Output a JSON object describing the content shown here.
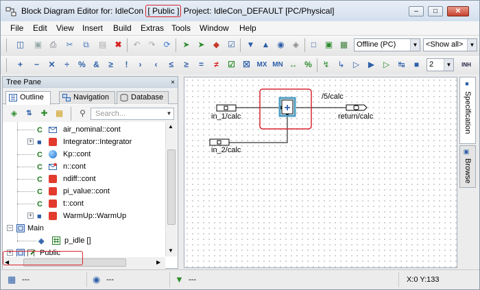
{
  "window": {
    "title_pre": "Block Diagram Editor for: IdleCon",
    "title_highlight": "[ Public ]",
    "title_post": "Project: IdleCon_DEFAULT [PC/Physical]",
    "min_label": "‒",
    "max_label": "□",
    "close_label": "✕"
  },
  "menu": [
    "File",
    "Edit",
    "View",
    "Insert",
    "Build",
    "Extras",
    "Tools",
    "Window",
    "Help"
  ],
  "toolbar1": {
    "mode_select": "Offline (PC)",
    "show_select": "<Show all>"
  },
  "toolbar2": {
    "glyphs": [
      "+",
      "−",
      "✕",
      "÷",
      "%",
      "&",
      "≥",
      "!",
      "›",
      "‹",
      "≤",
      "≥",
      "=",
      "≠",
      "☑",
      "☒",
      "MX",
      "MN",
      "↔",
      "%"
    ],
    "zoom_value": "2",
    "inh_label": "INH"
  },
  "tree_pane": {
    "title": "Tree Pane",
    "close_label": "×",
    "tabs": [
      "Outline",
      "Navigation",
      "Database"
    ],
    "search_placeholder": "Search...",
    "items": [
      {
        "label": "air_nominal::cont",
        "icon": "envelope"
      },
      {
        "label": "Integrator::Integrator",
        "icon": "red"
      },
      {
        "label": "Kp::cont",
        "icon": "globe"
      },
      {
        "label": "n::cont",
        "icon": "envelope"
      },
      {
        "label": "ndiff::cont",
        "icon": "red"
      },
      {
        "label": "pi_value::cont",
        "icon": "red"
      },
      {
        "label": "t::cont",
        "icon": "red"
      },
      {
        "label": "WarmUp::WarmUp",
        "icon": "red"
      }
    ],
    "main_label": "Main",
    "p_idle_label": "p_idle []",
    "public_label": "Public"
  },
  "diagram": {
    "in1": "in_1/calc",
    "in2": "in_2/calc",
    "out": "return/calc",
    "top_label": "/5/calc",
    "block_symbol": "+"
  },
  "side_tabs": [
    "Specification",
    "Browse"
  ],
  "status": {
    "s1": "---",
    "s2": "---",
    "s3": "---",
    "coords": "X:0 Y:133"
  }
}
